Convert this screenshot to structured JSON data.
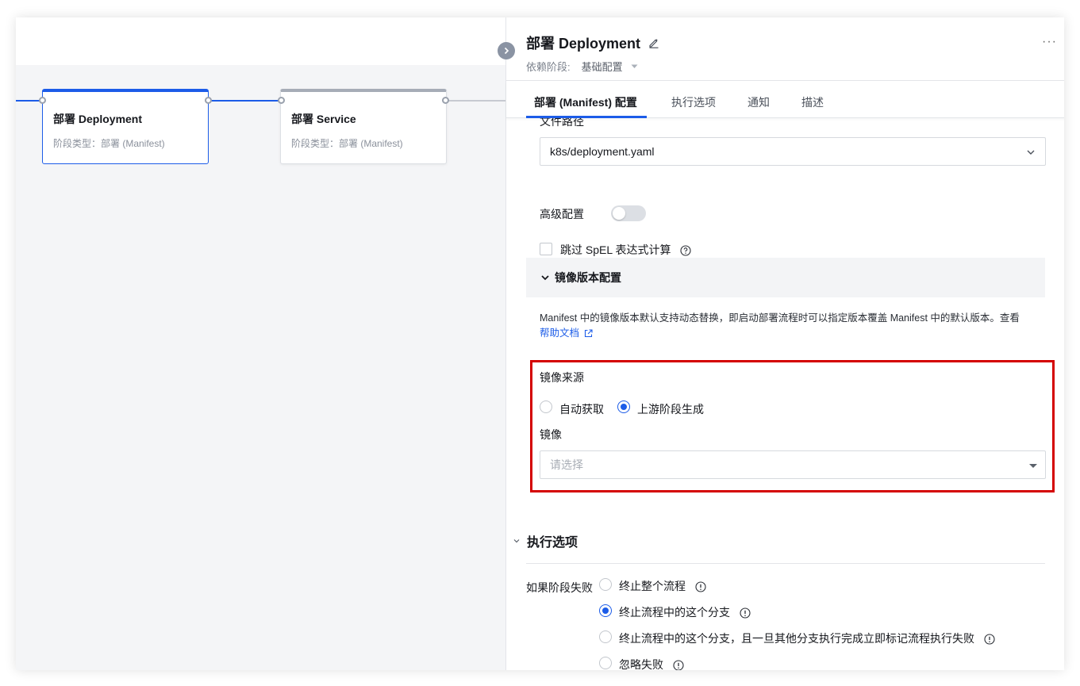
{
  "canvas": {
    "nodes": [
      {
        "title": "部署 Deployment",
        "subtitle": "阶段类型：部署 (Manifest)"
      },
      {
        "title": "部署 Service",
        "subtitle": "阶段类型：部署 (Manifest)"
      }
    ]
  },
  "drawer": {
    "title": "部署 Deployment",
    "dependency_label": "依赖阶段:",
    "dependency_value": "基础配置",
    "tabs": [
      "部署 (Manifest) 配置",
      "执行选项",
      "通知",
      "描述"
    ],
    "active_tab": 0
  },
  "form": {
    "file_path_label": "文件路径",
    "file_path_value": "k8s/deployment.yaml",
    "advanced_label": "高级配置",
    "advanced_enabled": false,
    "skip_spel_label": "跳过 SpEL 表达式计算",
    "skip_spel_checked": false,
    "image_section_title": "镜像版本配置",
    "image_desc": "Manifest 中的镜像版本默认支持动态替换，即启动部署流程时可以指定版本覆盖 Manifest 中的默认版本。查看",
    "help_link": "帮助文档",
    "image_source_label": "镜像来源",
    "image_source_options": [
      "自动获取",
      "上游阶段生成"
    ],
    "image_source_selected": 1,
    "image_label": "镜像",
    "image_placeholder": "请选择"
  },
  "exec_options": {
    "title": "执行选项",
    "failure_label": "如果阶段失败",
    "failure_options": [
      "终止整个流程",
      "终止流程中的这个分支",
      "终止流程中的这个分支，且一旦其他分支执行完成立即标记流程执行失败",
      "忽略失败"
    ],
    "failure_selected": 1
  },
  "colors": {
    "accent": "#1c5ce8",
    "highlight": "#d40000"
  }
}
